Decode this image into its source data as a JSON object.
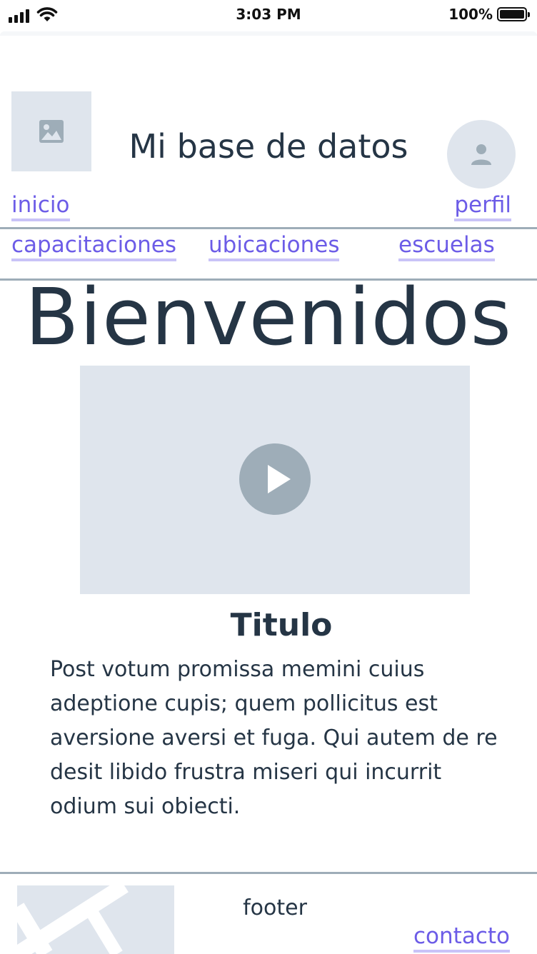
{
  "status_bar": {
    "time": "3:03 PM",
    "battery": "100%"
  },
  "header": {
    "title": "Mi base de datos",
    "logo_icon": "image-placeholder-icon",
    "avatar_icon": "user-icon"
  },
  "top_nav": {
    "left": "inicio",
    "right": "perfil"
  },
  "main_nav": {
    "items": [
      "capacitaciones",
      "ubicaciones",
      "escuelas"
    ]
  },
  "hero": {
    "heading": "Bienvenidos"
  },
  "video": {
    "icon": "play-icon"
  },
  "article": {
    "title": "Titulo",
    "body": "Post votum promissa memini cuius adeptione cupis; quem pollicitus est aversione aversi et fuga. Qui autem de re desit libido frustra miseri qui incurrit odium sui obiecti."
  },
  "footer": {
    "label": "footer",
    "link": "contacto",
    "map_icon": "map-placeholder"
  },
  "colors": {
    "link": "#6c5ce7",
    "link_underline": "#c9c3f7",
    "placeholder": "#dfe5ed",
    "divider": "#9eadb8",
    "text": "#253545"
  }
}
